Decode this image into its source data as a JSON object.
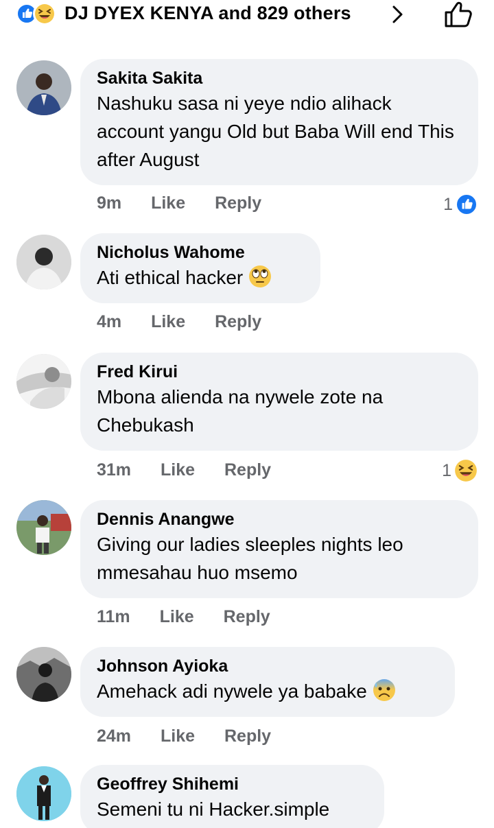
{
  "header": {
    "reactors_text": "DJ DYEX KENYA and 829 others",
    "icons": [
      "like-reaction-icon",
      "haha-reaction-icon",
      "chevron-right-icon",
      "like-outline-icon"
    ]
  },
  "comments": [
    {
      "author": "Sakita Sakita",
      "text": "Nashuku sasa ni yeye ndio alihack account yangu Old but Baba Will end This after August",
      "time": "9m",
      "like": "Like",
      "reply": "Reply",
      "reaction_count": "1",
      "reaction": "like"
    },
    {
      "author": "Nicholus Wahome",
      "text": "Ati ethical hacker",
      "emoji": "eye-roll-emoji",
      "time": "4m",
      "like": "Like",
      "reply": "Reply"
    },
    {
      "author": "Fred Kirui",
      "text": "Mbona alienda na nywele zote na Chebukash",
      "time": "31m",
      "like": "Like",
      "reply": "Reply",
      "reaction_count": "1",
      "reaction": "haha"
    },
    {
      "author": "Dennis Anangwe",
      "text": "Giving our ladies sleeples nights leo mmesahau huo msemo",
      "time": "11m",
      "like": "Like",
      "reply": "Reply"
    },
    {
      "author": "Johnson Ayioka",
      "text": "Amehack adi nywele ya babake",
      "emoji": "anxious-sweat-emoji",
      "time": "24m",
      "like": "Like",
      "reply": "Reply"
    },
    {
      "author": "Geoffrey Shihemi",
      "text": "Semeni tu ni Hacker.simple"
    }
  ],
  "colors": {
    "bubble": "#f0f2f5",
    "meta_text": "#65676b",
    "like_blue": "#1877f2",
    "haha_yellow": "#f7c84a"
  }
}
